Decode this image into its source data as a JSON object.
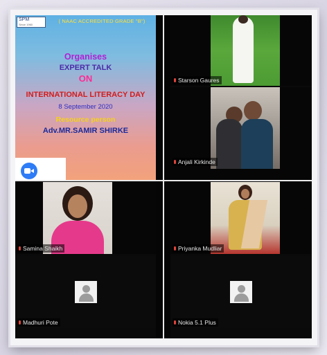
{
  "poster": {
    "logo": "SPM",
    "logo_sub": "Since 1960",
    "naac": "( NAAC ACCREDITED GRADE \"B\")",
    "organises": "Organises",
    "expert_talk": "EXPERT TALK",
    "on": "ON",
    "title": "INTERNATIONAL LITERACY DAY",
    "date": "8 September 2020",
    "resource_label": "Resource person",
    "speaker": "Adv.MR.SAMIR SHIRKE"
  },
  "participants": [
    {
      "name": "Starson Gaures",
      "video": true,
      "muted": true
    },
    {
      "name": "Anjali Kirkinde",
      "video": true,
      "muted": true
    },
    {
      "name": "Samina Shaikh",
      "video": true,
      "muted": true
    },
    {
      "name": "Priyanka Mudliar",
      "video": true,
      "muted": true
    },
    {
      "name": "Madhuri Pote",
      "video": false,
      "muted": true
    },
    {
      "name": "Nokia 5.1 Plus",
      "video": false,
      "muted": true
    }
  ],
  "colors": {
    "mic_muted": "#e0443a",
    "zoom_blue": "#2e7cf6"
  }
}
